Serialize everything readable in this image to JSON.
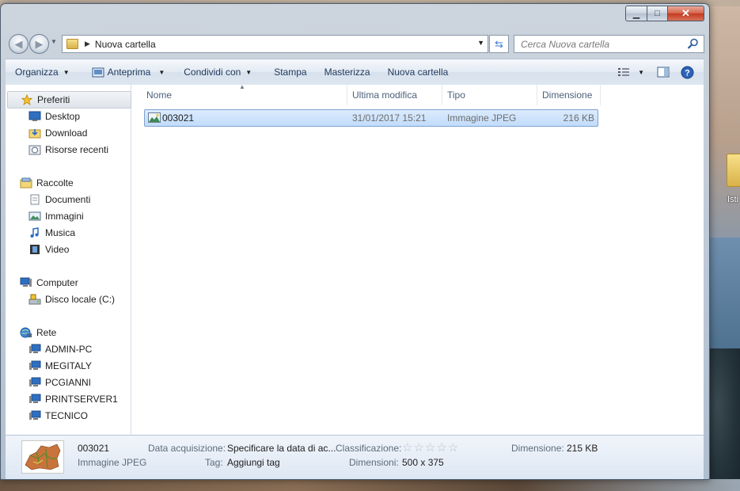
{
  "window": {
    "caption": {
      "minimize": "▁",
      "maximize": "□",
      "close": "✕"
    }
  },
  "nav": {
    "address_path": "Nuova cartella",
    "search_placeholder": "Cerca Nuova cartella"
  },
  "toolbar": {
    "organize": "Organizza",
    "preview": "Anteprima",
    "share": "Condividi con",
    "print": "Stampa",
    "burn": "Masterizza",
    "new_folder": "Nuova cartella"
  },
  "sidebar": {
    "favorites": {
      "label": "Preferiti",
      "items": [
        {
          "label": "Desktop",
          "icon": "desktop-icon"
        },
        {
          "label": "Download",
          "icon": "download-folder-icon"
        },
        {
          "label": "Risorse recenti",
          "icon": "recent-places-icon"
        }
      ]
    },
    "libraries": {
      "label": "Raccolte",
      "items": [
        {
          "label": "Documenti",
          "icon": "documents-icon"
        },
        {
          "label": "Immagini",
          "icon": "pictures-icon"
        },
        {
          "label": "Musica",
          "icon": "music-icon"
        },
        {
          "label": "Video",
          "icon": "video-icon"
        }
      ]
    },
    "computer": {
      "label": "Computer",
      "items": [
        {
          "label": "Disco locale (C:)",
          "icon": "local-disk-icon"
        }
      ]
    },
    "network": {
      "label": "Rete",
      "items": [
        {
          "label": "ADMIN-PC",
          "icon": "network-computer-icon"
        },
        {
          "label": "MEGITALY",
          "icon": "network-computer-icon"
        },
        {
          "label": "PCGIANNI",
          "icon": "network-computer-icon"
        },
        {
          "label": "PRINTSERVER1",
          "icon": "network-computer-icon"
        },
        {
          "label": "TECNICO",
          "icon": "network-computer-icon"
        }
      ]
    }
  },
  "columns": {
    "name": "Nome",
    "modified": "Ultima modifica",
    "type": "Tipo",
    "size": "Dimensione"
  },
  "files": [
    {
      "name": "003021",
      "modified": "31/01/2017 15:21",
      "type": "Immagine JPEG",
      "size": "216 KB"
    }
  ],
  "details": {
    "name": "003021",
    "type": "Immagine JPEG",
    "date_label": "Data acquisizione:",
    "date_value": "Specificare la data di ac...",
    "tags_label": "Tag:",
    "tags_value": "Aggiungi tag",
    "rating_label": "Classificazione:",
    "rating_stars": "☆☆☆☆☆",
    "dimensions_label": "Dimensioni:",
    "dimensions_value": "500 x 375",
    "size_label": "Dimensione:",
    "size_value": "215 KB"
  },
  "desktop": {
    "folder_label": "Isti"
  },
  "colors": {
    "selection": "#cce4fc",
    "link_text": "#1e395b"
  }
}
